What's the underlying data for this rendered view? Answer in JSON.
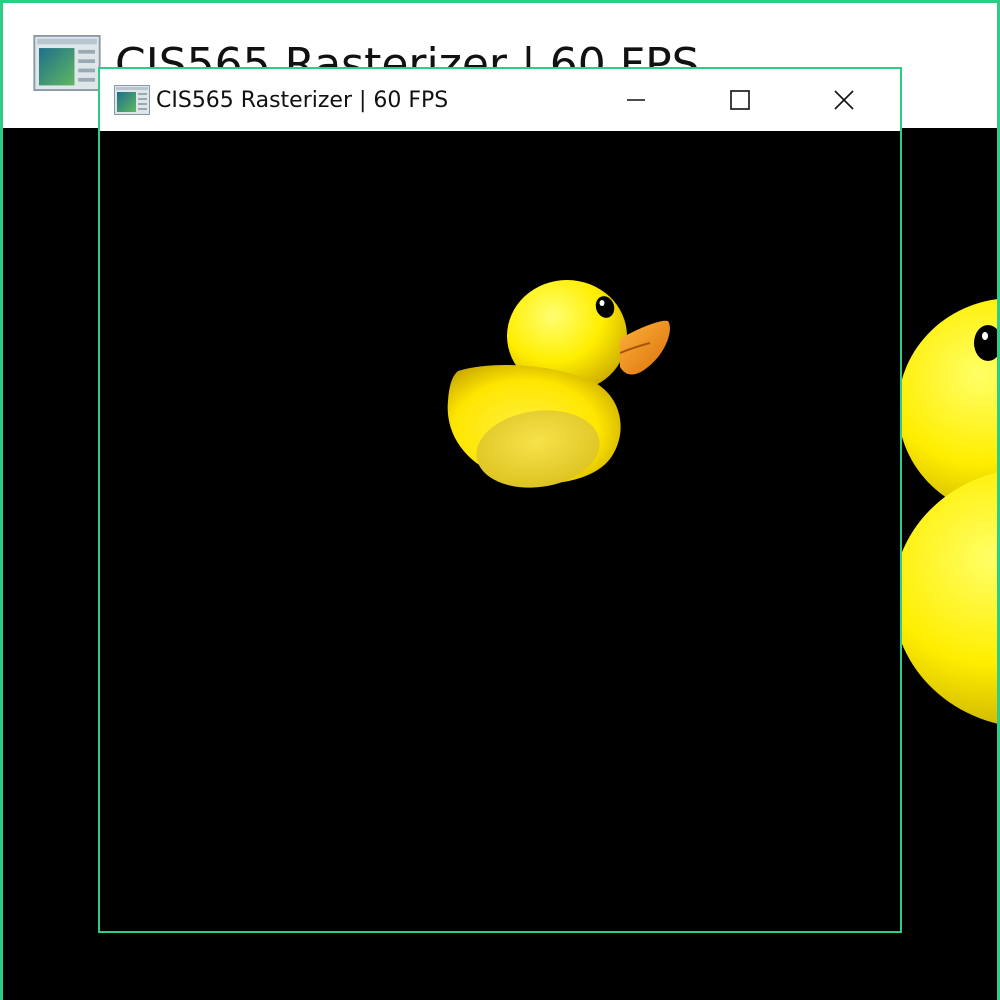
{
  "background_window": {
    "title": "CIS565 Rasterizer | 60 FPS",
    "icon": "application-window-icon"
  },
  "foreground_window": {
    "title": "CIS565 Rasterizer | 60 FPS",
    "icon": "application-window-icon",
    "controls": {
      "minimize_icon": "minimize-icon",
      "maximize_icon": "maximize-icon",
      "close_icon": "close-icon"
    }
  },
  "colors": {
    "window_border": "#2ecc85",
    "titlebar_bg": "#ffffff",
    "viewport_bg": "#000000",
    "duck_body": "#ffee00",
    "duck_beak": "#f29a1c"
  }
}
